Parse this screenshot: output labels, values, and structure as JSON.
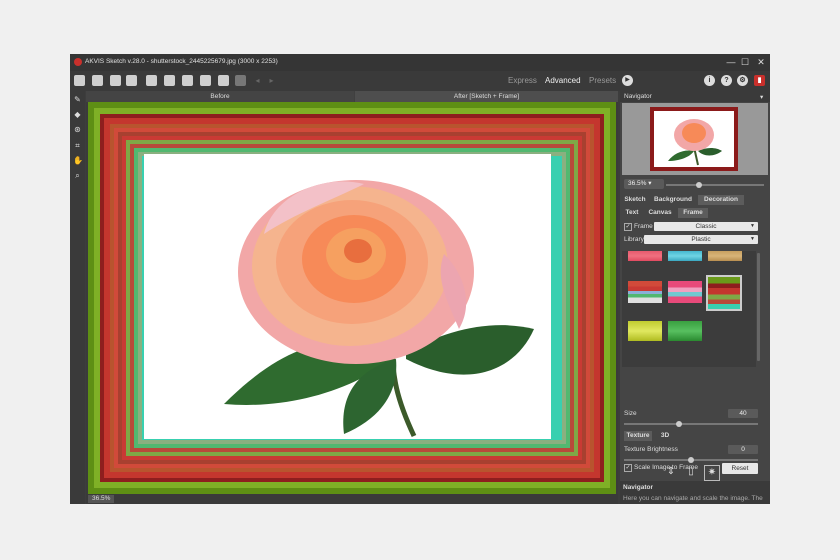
{
  "window": {
    "title": "AKVIS Sketch v.28.0 - shutterstock_2445225679.jpg (3000 x 2253)",
    "minimize_glyph": "—",
    "maximize_glyph": "☐",
    "close_glyph": "✕"
  },
  "toolbar": {
    "icons": [
      "open-icon",
      "save-icon",
      "export-icon",
      "print-icon",
      "batch-icon",
      "share-icon",
      "import-preset-icon",
      "check-icon",
      "apply-icon",
      "undo-icon",
      "redo-icon"
    ],
    "modes": {
      "express": "Express",
      "advanced": "Advanced",
      "presets": "Presets"
    },
    "run_glyph": "▶",
    "about_glyph": "i",
    "help_glyph": "?",
    "settings_glyph": "⚙",
    "book_glyph": "▮"
  },
  "left_tools": [
    {
      "name": "pencil-icon",
      "glyph": "✎"
    },
    {
      "name": "eraser-icon",
      "glyph": "◆"
    },
    {
      "name": "stamp-icon",
      "glyph": "⊛"
    },
    {
      "name": "crop-icon",
      "glyph": "⌗"
    },
    {
      "name": "hand-icon",
      "glyph": "✋"
    },
    {
      "name": "zoom-icon",
      "glyph": "⌕"
    }
  ],
  "view_tabs": {
    "before": "Before",
    "after": "After [Sketch + Frame]"
  },
  "status": {
    "zoom": "36.5%"
  },
  "navigator": {
    "header": "Navigator",
    "menu_glyph": "▾",
    "zoom": "36.5%"
  },
  "settings_tabs": {
    "sketch": "Sketch",
    "background": "Background",
    "decoration": "Decoration"
  },
  "decoration_tabs": {
    "text": "Text",
    "canvas": "Canvas",
    "frame": "Frame"
  },
  "frame": {
    "checkbox_label": "Frame",
    "checked": true,
    "type": "Classic",
    "library_label": "Library",
    "library": "Plastic",
    "size_label": "Size",
    "size": "40",
    "texture_tab": "Texture",
    "threed_tab": "3D",
    "brightness_label": "Texture Brightness",
    "brightness": "0",
    "scale_label": "Scale Image to Frame",
    "scale_checked": true,
    "reset": "Reset"
  },
  "help_panel": {
    "header": "Navigator",
    "text": "Here you can navigate and scale the image. The"
  },
  "colors": {
    "accent": "#c9302c",
    "frame_outer": "#6a9a1a",
    "frame_red": "#b5302d",
    "frame_teal": "#38d0b0"
  }
}
